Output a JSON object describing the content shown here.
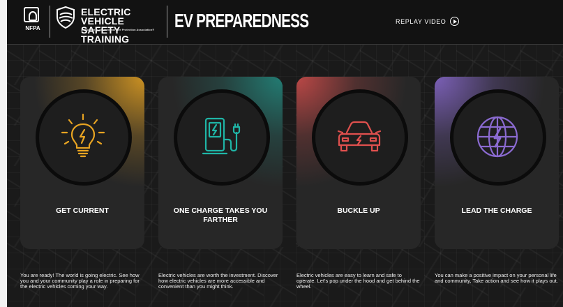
{
  "header": {
    "nfpa_logo_text": "NFPA",
    "brand_title_line1": "ELECTRIC VEHICLE",
    "brand_title_line2": "SAFETY TRAINING",
    "brand_subtitle": "A Program of the National Fire Protection Association®",
    "page_title": "EV PREPAREDNESS",
    "replay_label": "REPLAY VIDEO"
  },
  "colors": {
    "card1_accent": "#e8a422",
    "card2_accent": "#1fb5a6",
    "card3_accent": "#e0504e",
    "card4_accent": "#8a6ad0"
  },
  "cards": [
    {
      "label": "GET CURRENT",
      "icon": "lightbulb-icon",
      "description": "You are ready! The world is going electric. See how you and your community play a role in preparing for the electric vehicles coming your way."
    },
    {
      "label": "ONE CHARGE TAKES YOU FARTHER",
      "icon": "charging-station-icon",
      "description": "Electric vehicles are worth the investment. Discover how electric vehicles are more accessible and convenient than you might think."
    },
    {
      "label": "BUCKLE UP",
      "icon": "electric-car-icon",
      "description": "Electric vehicles are  easy to learn and safe to operate. Let's pop under the hood and get behind the wheel."
    },
    {
      "label": "LEAD THE CHARGE",
      "icon": "electric-globe-icon",
      "description": "You can make a positive impact on your personal life and community, Take action and see how it plays out."
    }
  ]
}
